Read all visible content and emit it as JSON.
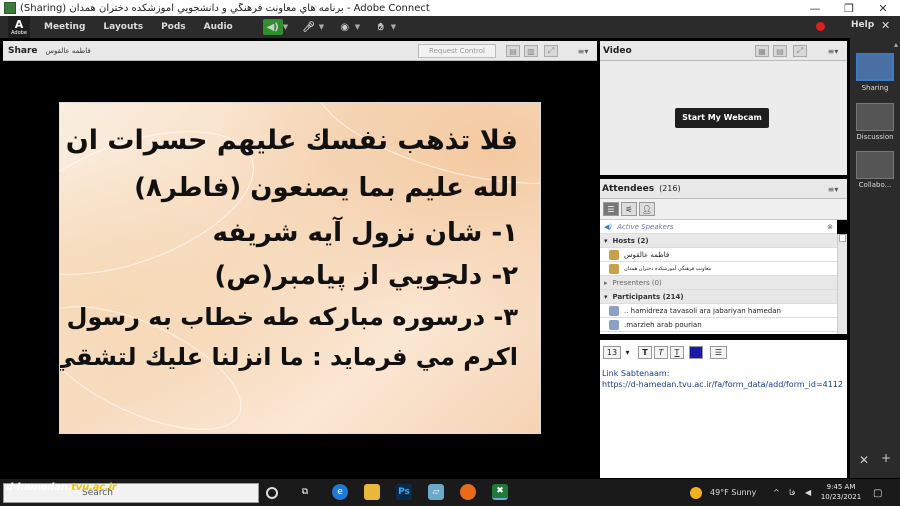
{
  "window": {
    "title": "(Sharing) برنامه هاي معاونت فرهنگي و دانشجويي آموزشكده دختران همدان - Adobe Connect",
    "min": "—",
    "max": "❐",
    "close": "✕"
  },
  "menubar": {
    "logo_letter": "A",
    "logo_text": "Adobe",
    "items": [
      "Meeting",
      "Layouts",
      "Pods",
      "Audio"
    ],
    "help": "Help",
    "close": "✕"
  },
  "share_pod": {
    "title": "Share",
    "presenter": "فاطمه عالقوس",
    "request_control": "Request Control"
  },
  "slide": {
    "lines": [
      "فلا تذهب نفسك عليهم حسرات ان",
      "الله عليم بما يصنعون (فاطر۸)",
      "۱- شان نزول آيه شريفه",
      "۲- دلجويي از پيامبر(ص)",
      "۳- درسوره مباركه طه خطاب به رسول",
      "اكرم  مي فرمايد : ما انزلنا عليك لتشقي"
    ]
  },
  "video_pod": {
    "title": "Video",
    "webcam_button": "Start My Webcam"
  },
  "attendees_pod": {
    "title": "Attendees",
    "count": "(216)",
    "active_speakers": "Active Speakers",
    "hosts_label": "Hosts (2)",
    "hosts": [
      "فاطمه عالقوس",
      "معاونت فرهنگي آموزشكده دختران همدان"
    ],
    "presenters_label": "Presenters (0)",
    "participants_label": "Participants (214)",
    "participants": [
      ".. hamidreza tavasoli ara jabariyan hamedan",
      ".marzieh arab pourian"
    ]
  },
  "chat": {
    "font_size": "13",
    "message_line1": "Link Sabtenaam:",
    "message_line2": "https://d-hamedan.tvu.ac.ir/fa/form_data/add/form_id=4112"
  },
  "layouts_panel": {
    "items": [
      "Sharing",
      "Discussion",
      "Collabo..."
    ]
  },
  "taskbar": {
    "brand_prefix": "d-hamedan.",
    "brand_highlight": "tvu.ac.ir",
    "search_placeholder": "Search",
    "weather": "49°F  Sunny",
    "lang": "فا",
    "time": "9:45 AM",
    "date": "10/23/2021"
  },
  "colors": {
    "menubar_bg": "#2b2b2b",
    "accent_blue": "#3c7ac2",
    "record_red": "#e02020",
    "chat_text": "#1a3a8a"
  }
}
